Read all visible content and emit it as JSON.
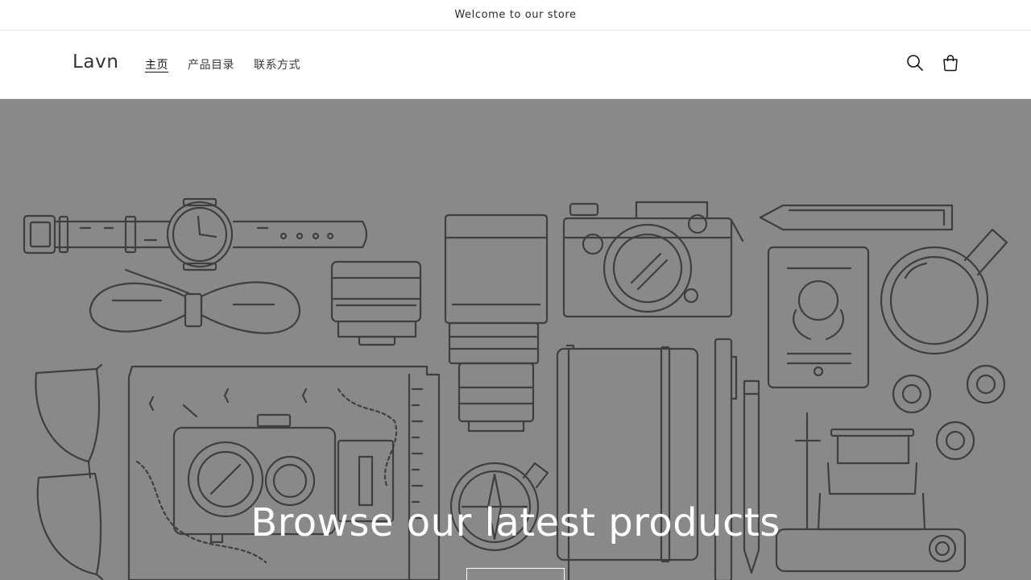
{
  "announcement": {
    "text": "Welcome to our store"
  },
  "header": {
    "logo": "Lavn",
    "nav": [
      {
        "label": "主页",
        "active": true
      },
      {
        "label": "产品目录",
        "active": false
      },
      {
        "label": "联系方式",
        "active": false
      }
    ],
    "icons": {
      "search": "search-icon",
      "cart": "cart-icon"
    }
  },
  "hero": {
    "title": "Browse our latest products",
    "background_color": "#898989",
    "illustration": "travel-items-line-art"
  }
}
